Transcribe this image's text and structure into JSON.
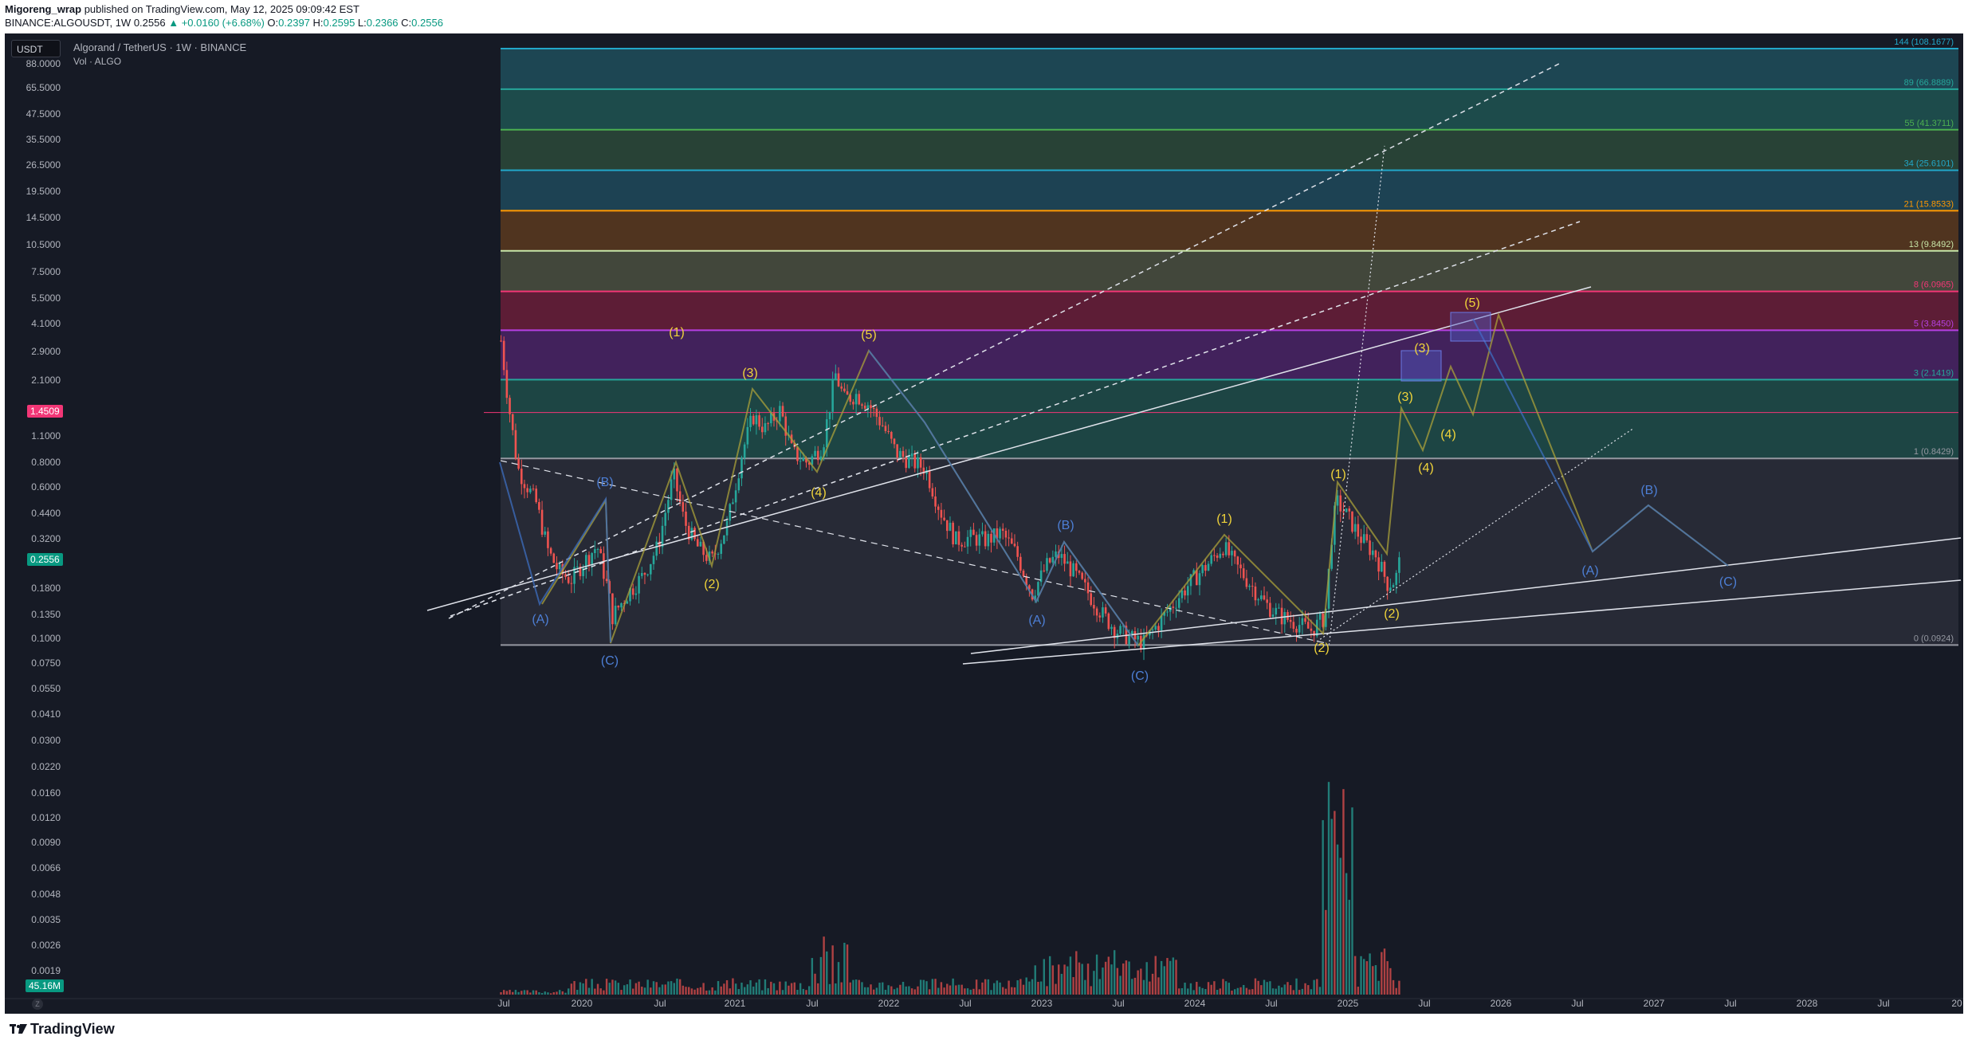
{
  "header": {
    "author": "Migoreng_wrap",
    "published": "published on TradingView.com, May 12, 2025 09:09:42 EST",
    "symbol": "BINANCE:ALGOUSDT, 1W",
    "price": "0.2556",
    "change": "▲ +0.0160 (+6.68%)",
    "o_label": "O:",
    "o": "0.2397",
    "h_label": "H:",
    "h": "0.2595",
    "l_label": "L:",
    "l": "0.2366",
    "c_label": "C:",
    "c": "0.2556"
  },
  "legend": {
    "currency": "USDT",
    "title": "Algorand / TetherUS · 1W · BINANCE",
    "volume": "Vol · ALGO"
  },
  "badges": {
    "line_price": "1.4509",
    "last_price": "0.2556",
    "volume": "45.16M"
  },
  "footer": {
    "brand": "TradingView",
    "zoom": "Z"
  },
  "colors": {
    "background": "#161a25",
    "up": "#26a69a",
    "down": "#ef5350",
    "wave_yellow": "#f0d43a",
    "wave_blue": "#4d7fd6"
  },
  "chart_data": {
    "type": "candlestick",
    "y_scale": "log",
    "y_ticks": [
      "88.0000",
      "65.5000",
      "47.5000",
      "35.5000",
      "26.5000",
      "19.5000",
      "14.5000",
      "10.5000",
      "7.5000",
      "5.5000",
      "4.1000",
      "2.9000",
      "2.1000",
      "1.1000",
      "0.8000",
      "0.6000",
      "0.4400",
      "0.3200",
      "0.1800",
      "0.1350",
      "0.1000",
      "0.0750",
      "0.0550",
      "0.0410",
      "0.0300",
      "0.0220",
      "0.0160",
      "0.0120",
      "0.0090",
      "0.0066",
      "0.0048",
      "0.0035",
      "0.0026",
      "0.0019"
    ],
    "x_ticks": [
      "Jul",
      "2020",
      "Jul",
      "2021",
      "Jul",
      "2022",
      "Jul",
      "2023",
      "Jul",
      "2024",
      "Jul",
      "2025",
      "Jul",
      "2026",
      "Jul",
      "2027",
      "Jul",
      "2028",
      "Jul",
      "20"
    ],
    "fib_levels": [
      {
        "label": "144 (108.1677)",
        "price": 108.1677,
        "color": "#22a7c9"
      },
      {
        "label": "89 (66.8889)",
        "price": 66.8889,
        "color": "#26a69a"
      },
      {
        "label": "55 (41.3711)",
        "price": 41.3711,
        "color": "#4caf50"
      },
      {
        "label": "34 (25.6101)",
        "price": 25.6101,
        "color": "#22a7c9"
      },
      {
        "label": "21 (15.8533)",
        "price": 15.8533,
        "color": "#ff9800"
      },
      {
        "label": "13 (9.8492)",
        "price": 9.8492,
        "color": "#c8e6a8"
      },
      {
        "label": "8 (6.0965)",
        "price": 6.0965,
        "color": "#f23676"
      },
      {
        "label": "5 (3.8450)",
        "price": 3.845,
        "color": "#b640e3"
      },
      {
        "label": "3 (2.1419)",
        "price": 2.1419,
        "color": "#26a69a"
      },
      {
        "label": "1 (0.8429)",
        "price": 0.8429,
        "color": "#9598a1"
      },
      {
        "label": "0 (0.0924)",
        "price": 0.0924,
        "color": "#9598a1"
      }
    ],
    "elliott_labels_yellow": [
      "(1)",
      "(2)",
      "(3)",
      "(4)",
      "(5)",
      "(1)",
      "(2)",
      "(1)",
      "(2)",
      "(3)",
      "(4)",
      "(3)",
      "(4)",
      "(5)"
    ],
    "elliott_labels_blue": [
      "(A)",
      "(B)",
      "(C)",
      "(A)",
      "(B)",
      "(C)",
      "(A)",
      "(B)",
      "(C)"
    ],
    "price_path": [
      {
        "t": 2019.47,
        "p": 3.4
      },
      {
        "t": 2019.52,
        "p": 1.6
      },
      {
        "t": 2019.58,
        "p": 0.75
      },
      {
        "t": 2019.7,
        "p": 0.5
      },
      {
        "t": 2019.78,
        "p": 0.28
      },
      {
        "t": 2019.85,
        "p": 0.22
      },
      {
        "t": 2019.93,
        "p": 0.2
      },
      {
        "t": 2020.0,
        "p": 0.24
      },
      {
        "t": 2020.1,
        "p": 0.3
      },
      {
        "t": 2020.17,
        "p": 0.18
      },
      {
        "t": 2020.2,
        "p": 0.13
      },
      {
        "t": 2020.3,
        "p": 0.17
      },
      {
        "t": 2020.4,
        "p": 0.21
      },
      {
        "t": 2020.5,
        "p": 0.3
      },
      {
        "t": 2020.6,
        "p": 0.7
      },
      {
        "t": 2020.67,
        "p": 0.4
      },
      {
        "t": 2020.75,
        "p": 0.3
      },
      {
        "t": 2020.85,
        "p": 0.25
      },
      {
        "t": 2020.95,
        "p": 0.38
      },
      {
        "t": 2021.05,
        "p": 0.9
      },
      {
        "t": 2021.12,
        "p": 1.4
      },
      {
        "t": 2021.2,
        "p": 1.2
      },
      {
        "t": 2021.3,
        "p": 1.5
      },
      {
        "t": 2021.38,
        "p": 0.9
      },
      {
        "t": 2021.48,
        "p": 0.8
      },
      {
        "t": 2021.58,
        "p": 1.0
      },
      {
        "t": 2021.66,
        "p": 2.3
      },
      {
        "t": 2021.72,
        "p": 1.7
      },
      {
        "t": 2021.8,
        "p": 1.8
      },
      {
        "t": 2021.88,
        "p": 1.6
      },
      {
        "t": 2021.97,
        "p": 1.25
      },
      {
        "t": 2022.06,
        "p": 0.9
      },
      {
        "t": 2022.15,
        "p": 0.82
      },
      {
        "t": 2022.25,
        "p": 0.75
      },
      {
        "t": 2022.35,
        "p": 0.45
      },
      {
        "t": 2022.45,
        "p": 0.32
      },
      {
        "t": 2022.55,
        "p": 0.33
      },
      {
        "t": 2022.65,
        "p": 0.32
      },
      {
        "t": 2022.75,
        "p": 0.35
      },
      {
        "t": 2022.85,
        "p": 0.27
      },
      {
        "t": 2022.95,
        "p": 0.17
      },
      {
        "t": 2023.05,
        "p": 0.24
      },
      {
        "t": 2023.12,
        "p": 0.27
      },
      {
        "t": 2023.22,
        "p": 0.22
      },
      {
        "t": 2023.32,
        "p": 0.17
      },
      {
        "t": 2023.42,
        "p": 0.13
      },
      {
        "t": 2023.5,
        "p": 0.11
      },
      {
        "t": 2023.6,
        "p": 0.1
      },
      {
        "t": 2023.68,
        "p": 0.095
      },
      {
        "t": 2023.78,
        "p": 0.12
      },
      {
        "t": 2023.9,
        "p": 0.16
      },
      {
        "t": 2024.0,
        "p": 0.2
      },
      {
        "t": 2024.1,
        "p": 0.24
      },
      {
        "t": 2024.2,
        "p": 0.3
      },
      {
        "t": 2024.28,
        "p": 0.24
      },
      {
        "t": 2024.38,
        "p": 0.19
      },
      {
        "t": 2024.48,
        "p": 0.15
      },
      {
        "t": 2024.58,
        "p": 0.13
      },
      {
        "t": 2024.68,
        "p": 0.12
      },
      {
        "t": 2024.78,
        "p": 0.11
      },
      {
        "t": 2024.87,
        "p": 0.13
      },
      {
        "t": 2024.92,
        "p": 0.4
      },
      {
        "t": 2024.95,
        "p": 0.5
      },
      {
        "t": 2025.02,
        "p": 0.42
      },
      {
        "t": 2025.1,
        "p": 0.33
      },
      {
        "t": 2025.2,
        "p": 0.27
      },
      {
        "t": 2025.28,
        "p": 0.19
      },
      {
        "t": 2025.33,
        "p": 0.2
      },
      {
        "t": 2025.36,
        "p": 0.2556
      }
    ]
  }
}
